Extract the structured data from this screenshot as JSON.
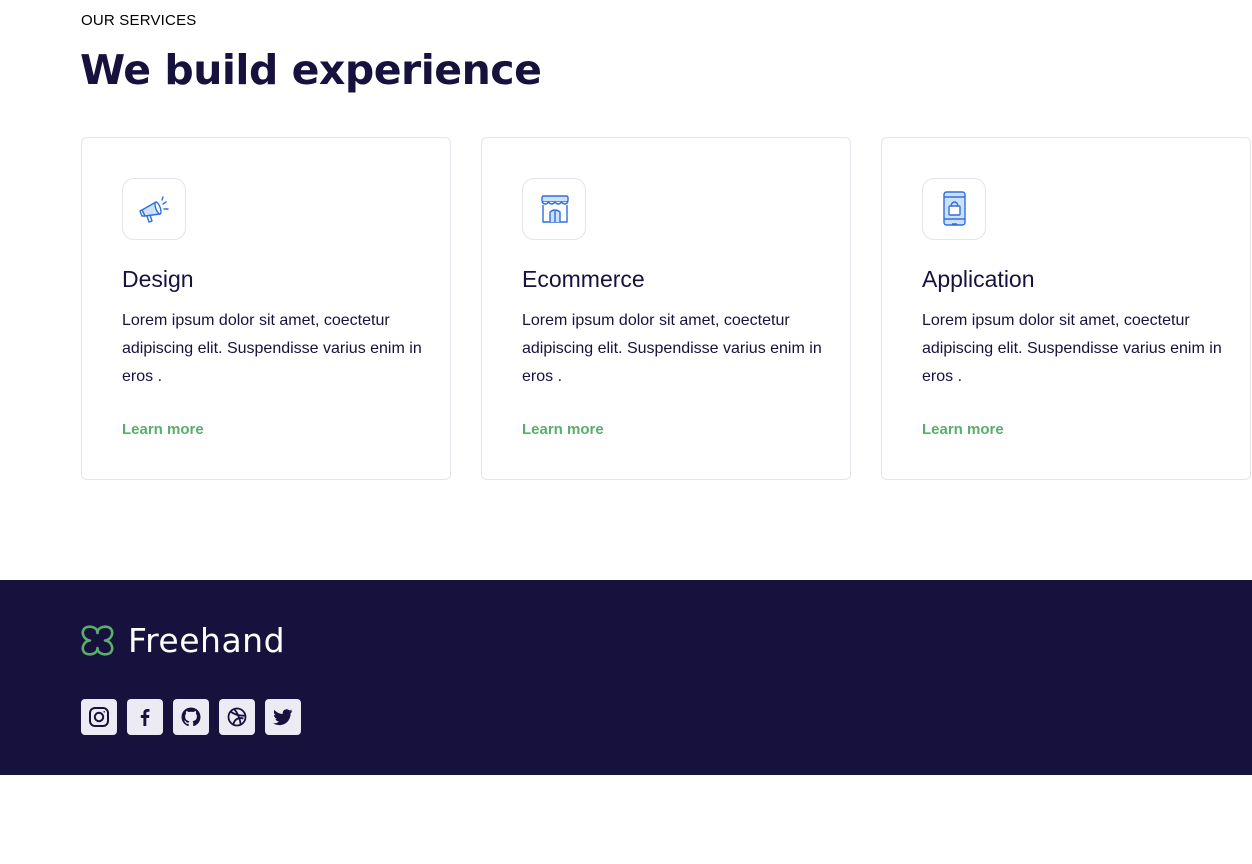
{
  "services": {
    "eyebrow": "OUR SERVICES",
    "headline": "We build experience",
    "cards": [
      {
        "icon": "megaphone-icon",
        "title": "Design",
        "text": "Lorem ipsum dolor sit amet, coectetur adipiscing elit. Suspendisse varius enim in eros .",
        "link": "Learn more"
      },
      {
        "icon": "storefront-icon",
        "title": "Ecommerce",
        "text": "Lorem ipsum dolor sit amet, coectetur adipiscing elit. Suspendisse varius enim in eros .",
        "link": "Learn more"
      },
      {
        "icon": "mobile-shopping-icon",
        "title": "Application",
        "text": "Lorem ipsum dolor sit amet, coectetur adipiscing elit. Suspendisse varius enim in eros .",
        "link": "Learn more"
      }
    ]
  },
  "footer": {
    "logo_text": "Freehand",
    "socials": [
      "instagram-icon",
      "facebook-icon",
      "github-icon",
      "dribbble-icon",
      "twitter-icon"
    ]
  },
  "colors": {
    "navy": "#16123d",
    "green": "#5aae6a",
    "icon_blue": "#2f6fdf"
  }
}
